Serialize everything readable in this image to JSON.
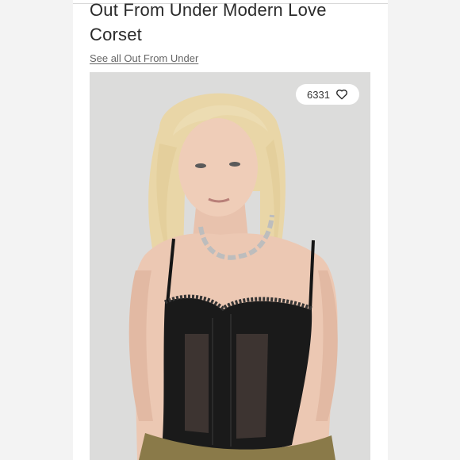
{
  "product": {
    "title": "Out From Under Modern Love Corset",
    "brand_link": "See all Out From Under"
  },
  "favorite": {
    "count": "6331",
    "icon": "heart-outline-icon"
  },
  "photo": {
    "subject": "model-wearing-black-lace-corset"
  },
  "colors": {
    "card_background": "#ffffff",
    "page_background": "#f3f3f3",
    "photo_background": "#dcdcdb",
    "title_text": "#2a2a2a",
    "link_text": "#666666"
  }
}
